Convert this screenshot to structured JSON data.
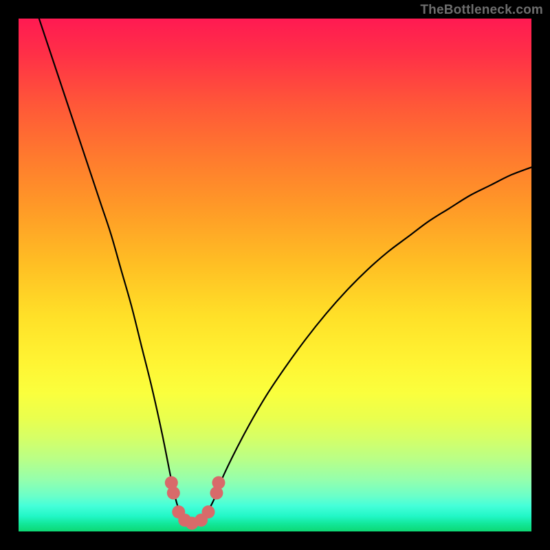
{
  "watermark": "TheBottleneck.com",
  "colors": {
    "frame": "#000000",
    "curve": "#000000",
    "marker_fill": "#d86a6a",
    "marker_stroke": "#c95e5e"
  },
  "chart_data": {
    "type": "line",
    "title": "",
    "xlabel": "",
    "ylabel": "",
    "xlim": [
      0,
      100
    ],
    "ylim": [
      0,
      100
    ],
    "grid": false,
    "series": [
      {
        "name": "bottleneck-curve",
        "x": [
          4,
          6,
          8,
          10,
          12,
          14,
          16,
          18,
          20,
          22,
          24,
          26,
          28,
          30,
          31,
          32,
          33,
          34,
          35,
          36,
          38,
          40,
          44,
          48,
          52,
          56,
          60,
          64,
          68,
          72,
          76,
          80,
          84,
          88,
          92,
          96,
          100
        ],
        "y": [
          100,
          94,
          88,
          82,
          76,
          70,
          64,
          58,
          51,
          44,
          36,
          28,
          19,
          9,
          5,
          2.5,
          1.5,
          1.3,
          1.5,
          2.5,
          6,
          11,
          19,
          26,
          32,
          37.5,
          42.5,
          47,
          51,
          54.5,
          57.5,
          60.5,
          63,
          65.5,
          67.5,
          69.5,
          71
        ]
      }
    ],
    "markers": [
      {
        "x": 29.8,
        "y": 9.5
      },
      {
        "x": 30.2,
        "y": 7.5
      },
      {
        "x": 31.2,
        "y": 3.8
      },
      {
        "x": 32.4,
        "y": 2.2
      },
      {
        "x": 33.8,
        "y": 1.6
      },
      {
        "x": 35.6,
        "y": 2.2
      },
      {
        "x": 37.0,
        "y": 3.8
      },
      {
        "x": 38.6,
        "y": 7.5
      },
      {
        "x": 39.0,
        "y": 9.5
      }
    ]
  }
}
